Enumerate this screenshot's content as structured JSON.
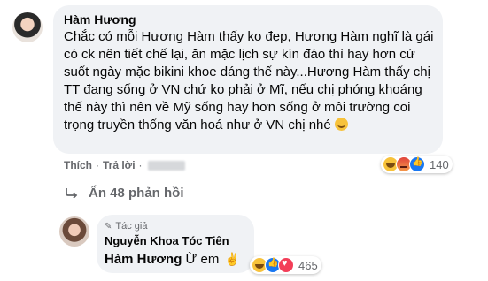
{
  "comment": {
    "author": "Hàm Hương",
    "text": "Chắc có mỗi Hương Hàm thấy ko đẹp, Hương Hàm nghĩ là gái có ck nên tiết chế lại, ăn mặc lịch sự kín đáo thì hay hơn cứ suốt ngày mặc bikini khoe dáng thế này...Hương Hàm thấy chị TT đang sống ở VN chứ ko phải ở Mĩ, nếu chị phóng khoáng thế này thì nên về Mỹ sống hay hơn sống ở môi trường coi trọng truyền thống văn hoá như ở VN chị nhé",
    "emoji": "slightly-smiling-face",
    "reactions": {
      "icons": [
        "haha",
        "angry",
        "like"
      ],
      "count": "140"
    },
    "actions": {
      "like": "Thích",
      "reply": "Trả lời"
    }
  },
  "replies_toggle": {
    "label": "Ẩn 48 phản hồi"
  },
  "reply": {
    "author_tag": "Tác giả",
    "author": "Nguyễn Khoa Tóc Tiên",
    "mention": "Hàm Hương",
    "text": "Ừ em",
    "emoji": "victory-hand",
    "reactions": {
      "icons": [
        "haha",
        "like",
        "love"
      ],
      "count": "465"
    }
  },
  "colors": {
    "bubble": "#f0f2f5",
    "secondary_text": "#65676b",
    "like_blue": "#1877f2",
    "love_red": "#f33e58",
    "haha_yellow": "#f7c23b"
  }
}
